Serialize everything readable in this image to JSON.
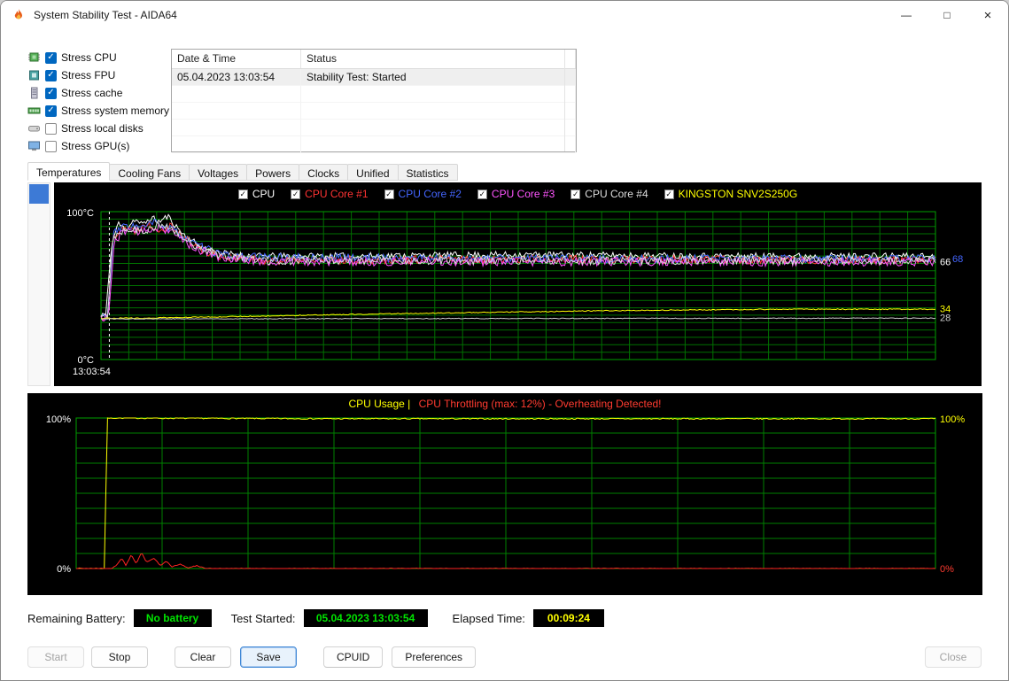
{
  "window": {
    "title": "System Stability Test - AIDA64",
    "controls": {
      "minimize": "—",
      "maximize": "□",
      "close": "×"
    }
  },
  "icons": [
    "flame-icon",
    "cpu-icon",
    "fpu-icon",
    "cache-icon",
    "memory-icon",
    "disk-icon",
    "gpu-icon",
    "minimize-icon",
    "maximize-icon",
    "close-icon"
  ],
  "stress_options": [
    {
      "label": "Stress CPU",
      "checked": true,
      "icon": "cpu-icon"
    },
    {
      "label": "Stress FPU",
      "checked": true,
      "icon": "fpu-icon"
    },
    {
      "label": "Stress cache",
      "checked": true,
      "icon": "cache-icon"
    },
    {
      "label": "Stress system memory",
      "checked": true,
      "icon": "memory-icon"
    },
    {
      "label": "Stress local disks",
      "checked": false,
      "icon": "disk-icon"
    },
    {
      "label": "Stress GPU(s)",
      "checked": false,
      "icon": "gpu-icon"
    }
  ],
  "event_log": {
    "columns": [
      "Date & Time",
      "Status"
    ],
    "rows": [
      {
        "datetime": "05.04.2023 13:03:54",
        "status": "Stability Test: Started"
      }
    ]
  },
  "tabs": [
    {
      "label": "Temperatures",
      "selected": true
    },
    {
      "label": "Cooling Fans",
      "selected": false
    },
    {
      "label": "Voltages",
      "selected": false
    },
    {
      "label": "Powers",
      "selected": false
    },
    {
      "label": "Clocks",
      "selected": false
    },
    {
      "label": "Unified",
      "selected": false
    },
    {
      "label": "Statistics",
      "selected": false
    }
  ],
  "chart_data": [
    {
      "type": "line",
      "title": "Temperatures",
      "ylim": [
        0,
        100
      ],
      "ylabel": "°C",
      "axis_labels": {
        "top": "100°C",
        "bottom": "0°C"
      },
      "x_start_label": "13:03:54",
      "grid": {
        "v_divisions": 30,
        "h_divisions": 20,
        "color": "#007000",
        "frame_color": "#00a000"
      },
      "marker_x": 0.01,
      "legend_position": "top-center",
      "series": [
        {
          "name": "CPU",
          "color": "#ffffff",
          "seed": 11,
          "noise": 2.2,
          "points": [
            [
              0,
              29
            ],
            [
              0.006,
              30
            ],
            [
              0.012,
              75
            ],
            [
              0.02,
              92
            ],
            [
              0.03,
              88
            ],
            [
              0.04,
              95
            ],
            [
              0.05,
              91
            ],
            [
              0.06,
              96
            ],
            [
              0.07,
              93
            ],
            [
              0.08,
              97
            ],
            [
              0.09,
              90
            ],
            [
              0.1,
              84
            ],
            [
              0.12,
              76
            ],
            [
              0.145,
              72
            ],
            [
              0.18,
              70
            ],
            [
              0.3,
              70
            ],
            [
              0.5,
              71
            ],
            [
              0.75,
              70
            ],
            [
              1,
              70
            ]
          ]
        },
        {
          "name": "CPU Core #1",
          "color": "#ff3333",
          "seed": 22,
          "noise": 2.8,
          "points": [
            [
              0,
              28
            ],
            [
              0.008,
              29
            ],
            [
              0.014,
              82
            ],
            [
              0.025,
              90
            ],
            [
              0.04,
              87
            ],
            [
              0.055,
              92
            ],
            [
              0.07,
              88
            ],
            [
              0.085,
              91
            ],
            [
              0.1,
              82
            ],
            [
              0.12,
              74
            ],
            [
              0.15,
              69
            ],
            [
              0.2,
              67
            ],
            [
              0.5,
              68
            ],
            [
              1,
              67
            ]
          ]
        },
        {
          "name": "CPU Core #2",
          "color": "#4466ff",
          "seed": 33,
          "noise": 2.8,
          "points": [
            [
              0,
              29
            ],
            [
              0.008,
              30
            ],
            [
              0.015,
              85
            ],
            [
              0.03,
              91
            ],
            [
              0.05,
              89
            ],
            [
              0.065,
              93
            ],
            [
              0.08,
              89
            ],
            [
              0.095,
              85
            ],
            [
              0.115,
              77
            ],
            [
              0.15,
              70
            ],
            [
              0.2,
              69
            ],
            [
              0.6,
              68
            ],
            [
              1,
              68
            ]
          ]
        },
        {
          "name": "CPU Core #3",
          "color": "#ff55ff",
          "seed": 44,
          "noise": 2.8,
          "points": [
            [
              0,
              28
            ],
            [
              0.009,
              29
            ],
            [
              0.016,
              80
            ],
            [
              0.03,
              88
            ],
            [
              0.05,
              86
            ],
            [
              0.07,
              90
            ],
            [
              0.09,
              84
            ],
            [
              0.11,
              76
            ],
            [
              0.14,
              69
            ],
            [
              0.2,
              66
            ],
            [
              0.5,
              66
            ],
            [
              1,
              66
            ]
          ]
        },
        {
          "name": "CPU Core #4",
          "color": "#dddddd",
          "seed": 55,
          "noise": 2.8,
          "points": [
            [
              0,
              29
            ],
            [
              0.008,
              30
            ],
            [
              0.014,
              83
            ],
            [
              0.03,
              89
            ],
            [
              0.05,
              87
            ],
            [
              0.07,
              91
            ],
            [
              0.09,
              86
            ],
            [
              0.11,
              78
            ],
            [
              0.145,
              70
            ],
            [
              0.2,
              67
            ],
            [
              0.6,
              67
            ],
            [
              1,
              67
            ]
          ]
        },
        {
          "name": "KINGSTON SNV2S250G",
          "color": "#ffff00",
          "seed": 66,
          "noise": 0.3,
          "points": [
            [
              0,
              28
            ],
            [
              0.05,
              28
            ],
            [
              0.15,
              29
            ],
            [
              0.35,
              31
            ],
            [
              0.6,
              33
            ],
            [
              0.8,
              34
            ],
            [
              1,
              34
            ]
          ]
        },
        {
          "name": "",
          "color": "#c8c8c8",
          "seed": 77,
          "noise": 0.25,
          "points": [
            [
              0,
              27.5
            ],
            [
              1,
              28
            ]
          ]
        }
      ],
      "right_labels": [
        {
          "text": "66",
          "value": 66,
          "color": "#ffffff",
          "dx": 2
        },
        {
          "text": "68",
          "value": 68,
          "color": "#4466ff",
          "dx": 16
        },
        {
          "text": "34",
          "value": 34,
          "color": "#ffff00",
          "dx": 2
        },
        {
          "text": "28",
          "value": 28,
          "color": "#cccccc",
          "dx": 2
        }
      ]
    },
    {
      "type": "line",
      "title_primary": "CPU Usage  |",
      "title_alert": "CPU Throttling (max: 12%) - Overheating Detected!",
      "title_colors": {
        "primary": "#ffff00",
        "alert": "#ff3b30"
      },
      "ylim": [
        0,
        100
      ],
      "grid": {
        "v_divisions": 10,
        "h_divisions": 10,
        "color": "#008000",
        "frame_color": "#00a000"
      },
      "axis_labels": {
        "left_top": "100%",
        "left_bottom": "0%",
        "right_top": "100%",
        "right_bottom": "0%"
      },
      "axis_label_colors": {
        "left": "#ffffff",
        "right_top": "#ffff00",
        "right_bottom": "#ff3b30"
      },
      "series": [
        {
          "name": "CPU Usage",
          "color": "#ffff00",
          "seed": 7,
          "noise": 0.4,
          "points": [
            [
              0,
              0
            ],
            [
              0.033,
              0
            ],
            [
              0.036,
              100
            ],
            [
              0.3,
              99.5
            ],
            [
              1,
              99.5
            ]
          ]
        },
        {
          "name": "CPU Throttling",
          "color": "#ff2222",
          "seed": 8,
          "noise": 0.3,
          "points": [
            [
              0,
              0
            ],
            [
              0.042,
              0
            ],
            [
              0.048,
              3
            ],
            [
              0.053,
              7
            ],
            [
              0.058,
              2
            ],
            [
              0.064,
              9
            ],
            [
              0.07,
              3
            ],
            [
              0.076,
              11
            ],
            [
              0.082,
              4
            ],
            [
              0.09,
              7
            ],
            [
              0.098,
              2
            ],
            [
              0.105,
              5
            ],
            [
              0.112,
              1
            ],
            [
              0.12,
              3
            ],
            [
              0.13,
              0.5
            ],
            [
              0.14,
              2
            ],
            [
              0.15,
              0
            ],
            [
              1,
              0
            ]
          ]
        }
      ]
    }
  ],
  "status_bar": {
    "battery_label": "Remaining Battery:",
    "battery_value": "No battery",
    "battery_color": "#00e400",
    "test_started_label": "Test Started:",
    "test_started_value": "05.04.2023 13:03:54",
    "test_started_color": "#00e400",
    "elapsed_label": "Elapsed Time:",
    "elapsed_value": "00:09:24",
    "elapsed_color": "#ffff00"
  },
  "buttons": {
    "start": "Start",
    "stop": "Stop",
    "clear": "Clear",
    "save": "Save",
    "cpuid": "CPUID",
    "preferences": "Preferences",
    "close": "Close"
  }
}
